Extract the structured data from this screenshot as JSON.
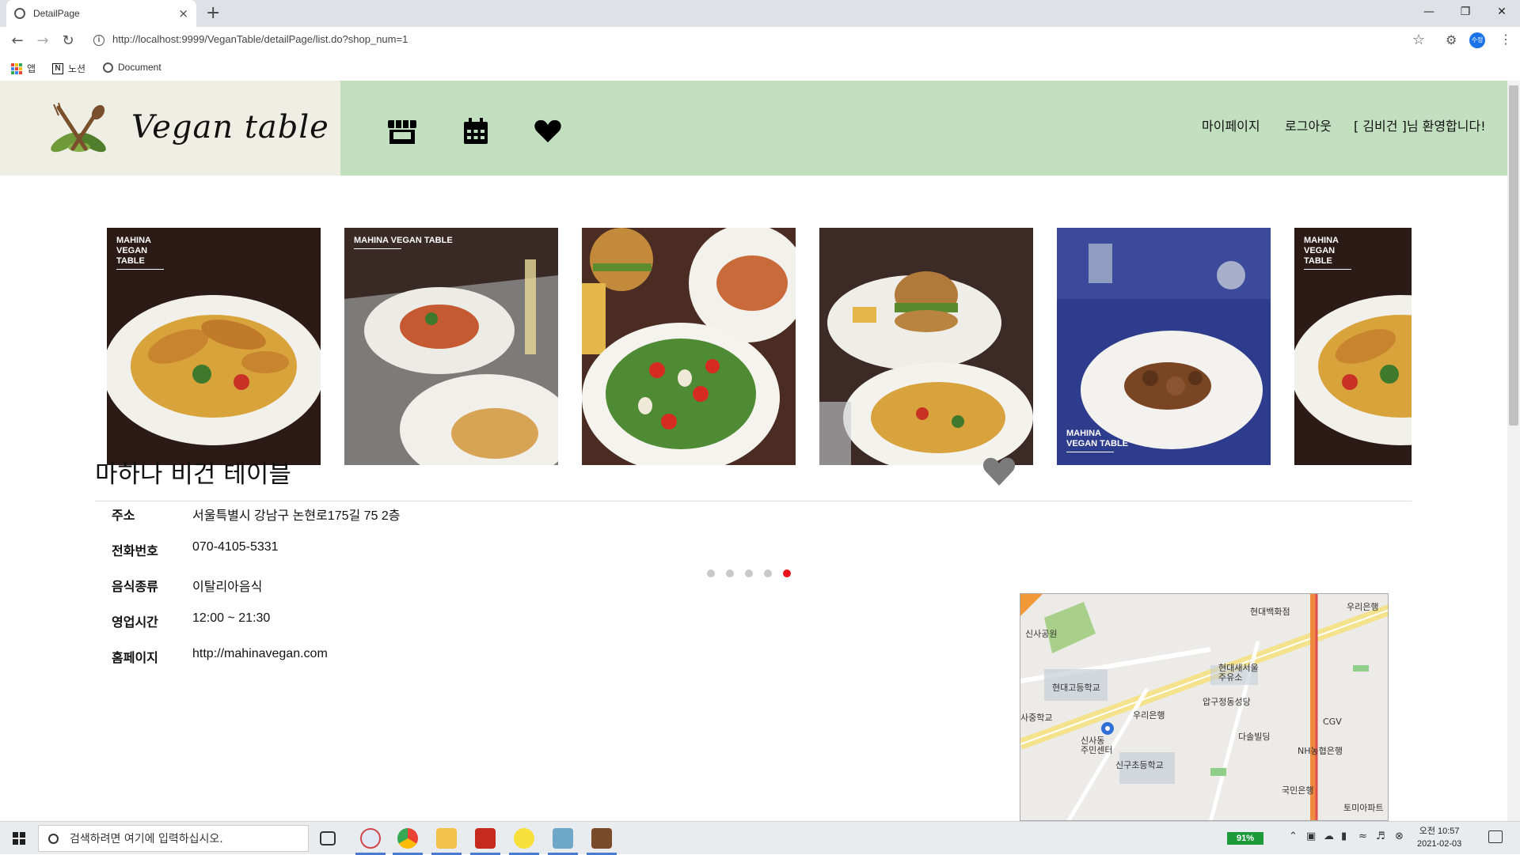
{
  "browser": {
    "tab_title": "DetailPage",
    "tab_close": "×",
    "new_tab": "+",
    "url": "http://localhost:9999/VeganTable/detailPage/list.do?shop_num=1",
    "profile_initials": "수정",
    "bookmarks": [
      "앱",
      "노션",
      "Document"
    ]
  },
  "site": {
    "logo_text": "Vegan table",
    "nav": [
      "store-icon",
      "calendar-icon",
      "heart-icon"
    ],
    "links": {
      "mypage": "마이페이지",
      "logout": "로그아웃",
      "welcome": "[ 김비건 ]님 환영합니다!"
    },
    "colors": {
      "header_green": "#c2dfc0",
      "header_beige": "#eeeee4",
      "active_dot": "#e8121b"
    }
  },
  "carousel": {
    "slides": [
      {
        "caption": "MAHINA\nVEGAN\nTABLE"
      },
      {
        "caption": "MAHINA VEGAN TABLE"
      },
      {
        "caption": ""
      },
      {
        "caption": ""
      },
      {
        "caption": "MAHINA\nVEGAN TABLE"
      },
      {
        "caption": "MAHINA\nVEGAN\nTABLE"
      }
    ],
    "dot_count": 5,
    "active_index": 5
  },
  "shop": {
    "name": "마하나 비건 테이블",
    "info": [
      {
        "label": "주소",
        "value": "서울특별시 강남구 논현로175길 75 2층"
      },
      {
        "label": "전화번호",
        "value": "070-4105-5331"
      },
      {
        "label": "음식종류",
        "value": "이탈리아음식"
      },
      {
        "label": "영업시간",
        "value": "12:00 ~ 21:30"
      },
      {
        "label": "홈페이지",
        "value": "http://mahinavegan.com"
      }
    ],
    "map_labels": [
      "현대백화점",
      "우리은행",
      "신사공원",
      "현대고등학교",
      "현대새서울\n주유소",
      "압구정동성당",
      "사중학교",
      "우리은행",
      "CGV",
      "신사동\n주민센터",
      "다솔빌딩",
      "NH농협은행",
      "신구초등학교",
      "국민은행",
      "토미아파트"
    ]
  },
  "taskbar": {
    "search_placeholder": "검색하려면 여기에 입력하십시오.",
    "battery": "91%",
    "time": "오전 10:57",
    "date": "2021-02-03"
  }
}
